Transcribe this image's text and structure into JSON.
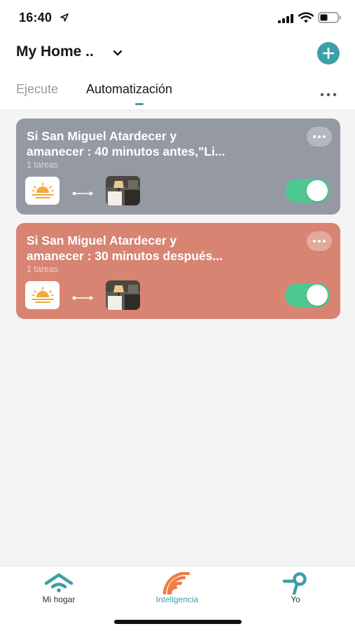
{
  "status_bar": {
    "time": "16:40",
    "icons": [
      "location-arrow-icon",
      "signal-icon",
      "wifi-icon",
      "battery-icon"
    ]
  },
  "header": {
    "home_name": "My Home ..",
    "icons": [
      "chevron-down-icon",
      "plus-icon"
    ]
  },
  "tabs": [
    {
      "label": "Ejecute",
      "active": false
    },
    {
      "label": "Automatización",
      "active": true
    }
  ],
  "colors": {
    "accent": "#3d9fa7",
    "toggle_on": "#4dc891",
    "card_1_bg": "#9499a3",
    "card_2_bg": "#d88473",
    "sun_icon": "#f2a93b"
  },
  "automations": [
    {
      "title": "Si San Miguel Atardecer y\namanecer : 40 minutos antes,\"Li...",
      "tasks": "1 tareas",
      "enabled": true,
      "condition_icon": "sunrise-icon",
      "action_icon": "device-thumbnail"
    },
    {
      "title": "Si San Miguel Atardecer y\namanecer : 30 minutos después...",
      "tasks": "1 tareas",
      "enabled": true,
      "condition_icon": "sunrise-icon",
      "action_icon": "device-thumbnail"
    }
  ],
  "bottom_nav": [
    {
      "label": "Mi hogar",
      "icon": "home-wifi-icon",
      "active": false
    },
    {
      "label": "Inteligencia",
      "icon": "smart-wave-icon",
      "active": true
    },
    {
      "label": "Yo",
      "icon": "person-icon",
      "active": false
    }
  ]
}
